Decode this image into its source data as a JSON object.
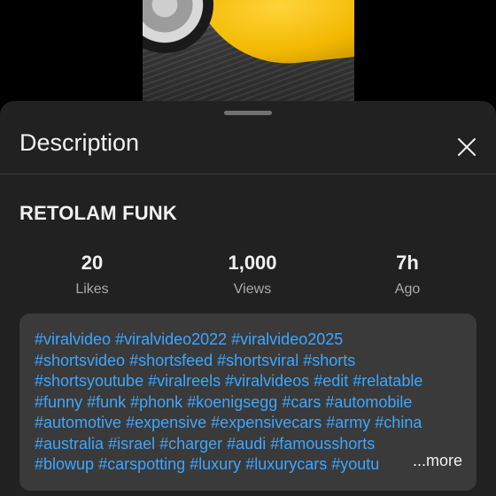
{
  "sheet": {
    "title": "Description",
    "close_icon": "close-icon"
  },
  "channel_name": "RETOLAM FUNK",
  "stats": [
    {
      "value": "20",
      "label": "Likes"
    },
    {
      "value": "1,000",
      "label": "Views"
    },
    {
      "value": "7h",
      "label": "Ago"
    }
  ],
  "description": {
    "lines": [
      [
        "#viralvideo",
        "#viralvideo2022",
        "#viralvideo2025"
      ],
      [
        "#shortsvideo",
        "#shortsfeed",
        "#shortsviral",
        "#shorts"
      ],
      [
        "#shortsyoutube",
        "#viralreels",
        "#viralvideos",
        "#edit",
        "#relatable"
      ],
      [
        "#funny",
        "#funk",
        "#phonk",
        "#koenigsegg",
        "#cars",
        "#automobile"
      ],
      [
        "#automotive",
        "#expensive",
        "#expensivecars",
        "#army",
        "#china"
      ],
      [
        "#australia",
        "#israel",
        "#charger",
        "#audi",
        "#famousshorts"
      ],
      [
        "#blowup",
        "#carspotting",
        "#luxury",
        "#luxurycars",
        "#youtu"
      ]
    ],
    "more_label": "...more"
  },
  "colors": {
    "background": "#000000",
    "sheet": "#212121",
    "hashtag": "#3ea6ff",
    "description_box": "#3a3a3a"
  }
}
